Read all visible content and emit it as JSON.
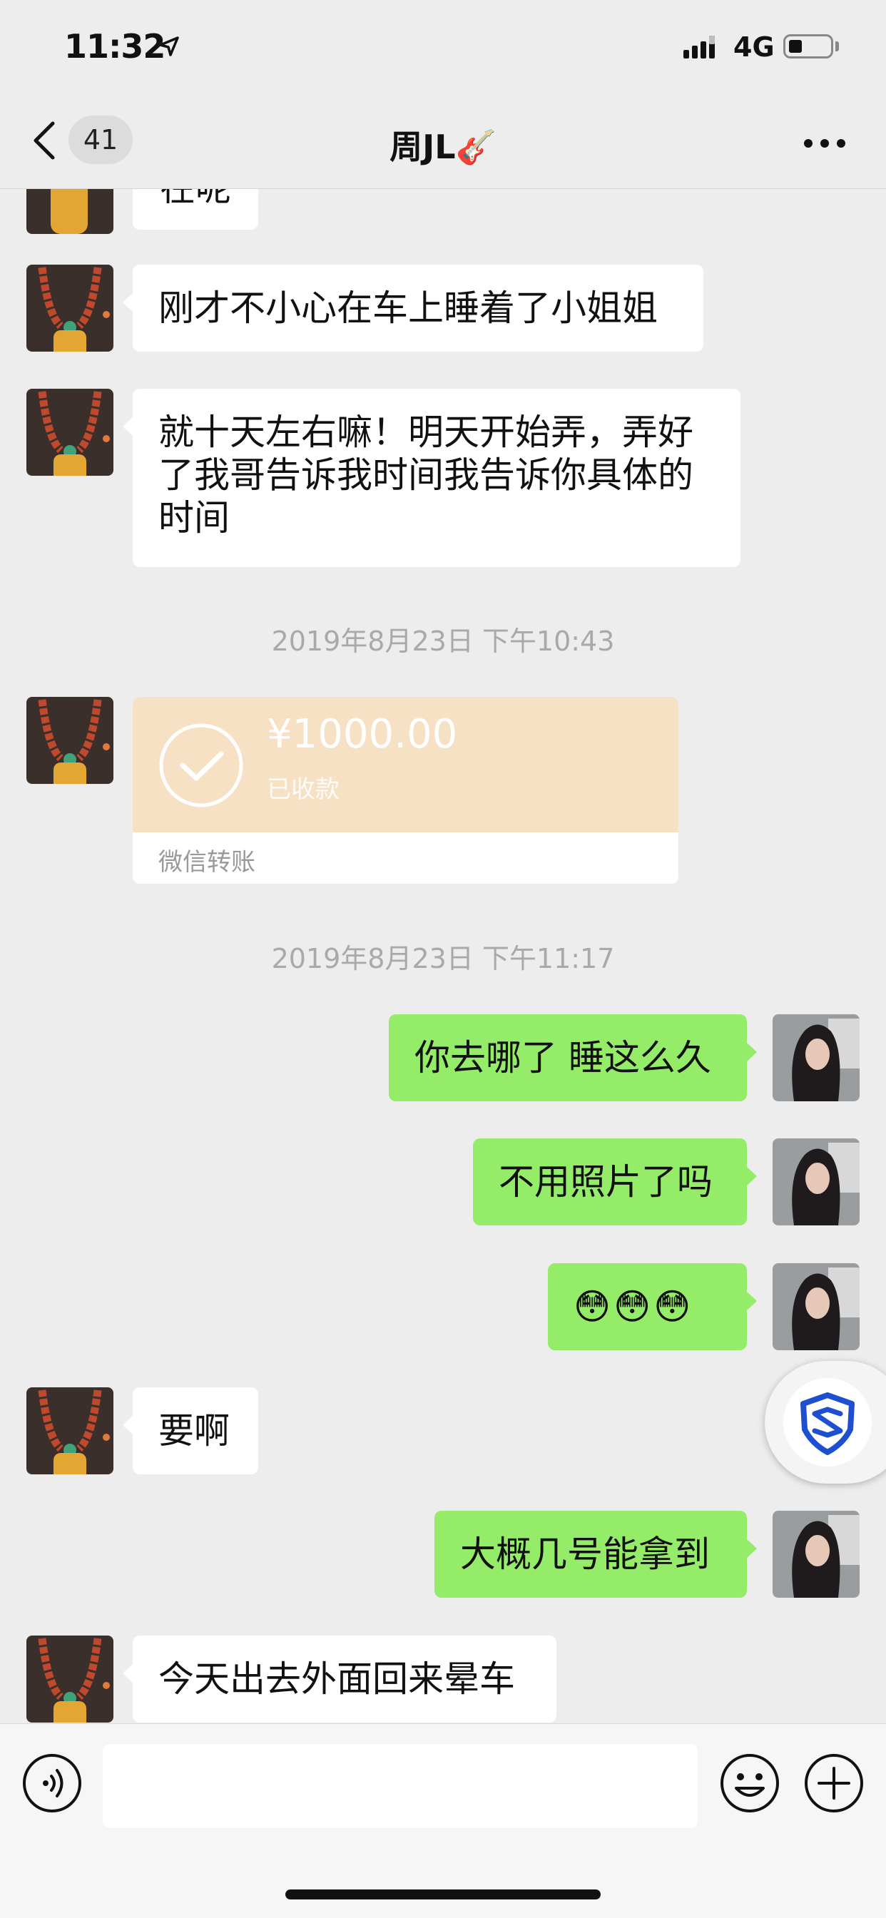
{
  "status_bar": {
    "time": "11:32",
    "network": "4G"
  },
  "nav": {
    "unread_count": "41",
    "title": "周JL🎸"
  },
  "messages": {
    "m0": "在呢",
    "m1": "刚才不小心在车上睡着了小姐姐",
    "m2": "就十天左右嘛！明天开始弄，弄好了我哥告诉我时间我告诉你具体的时间",
    "ts1": "2019年8月23日 下午10:43",
    "transfer": {
      "amount": "¥1000.00",
      "status": "已收款",
      "label": "微信转账"
    },
    "ts2": "2019年8月23日 下午11:17",
    "m3": "你去哪了 睡这么久",
    "m4": "不用照片了吗",
    "m5": "😳😳😳",
    "m6": "要啊",
    "m7": "大概几号能拿到",
    "m8": "今天出去外面回来晕车"
  },
  "colors": {
    "background": "#ededed",
    "bubble_received": "#ffffff",
    "bubble_sent": "#95ec69",
    "transfer_card": "#f7e1c4",
    "timestamp": "#a9a9a9"
  },
  "icons": {
    "nav_back": "chevron-left-icon",
    "nav_more": "more-dots-icon",
    "voice": "voice-icon",
    "emoji": "emoji-icon",
    "plus": "plus-icon",
    "floating": "shield-icon"
  }
}
